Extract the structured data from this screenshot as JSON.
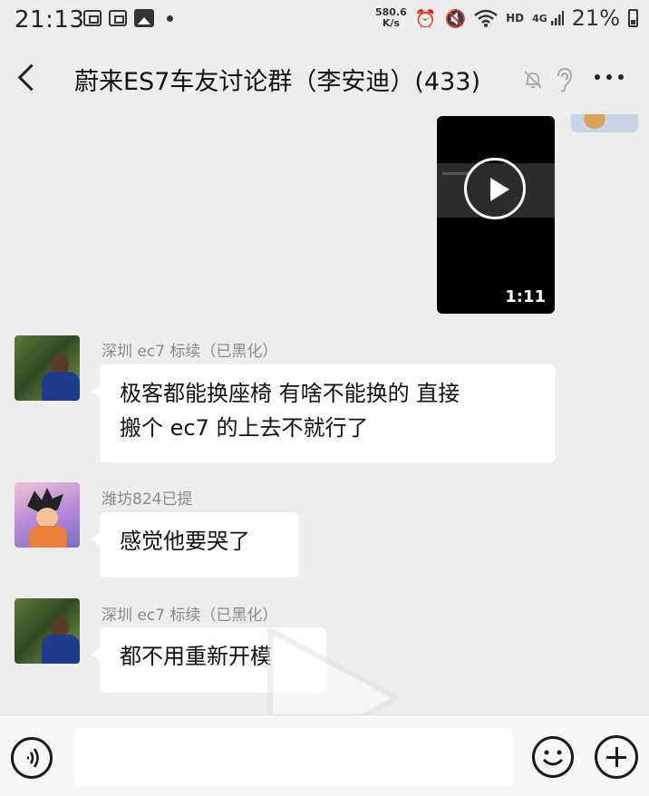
{
  "status_bar": {
    "time": "21:13",
    "net_speed_value": "580.6",
    "net_speed_unit": "K/s",
    "hd_label": "HD",
    "signal_label": "4G",
    "battery": "21%"
  },
  "header": {
    "title": "蔚来ES7车友讨论群（李安迪）(433)"
  },
  "video": {
    "duration": "1:11"
  },
  "messages": [
    {
      "sender": "深圳 ec7 标续（已黑化）",
      "text_line1": "极客都能换座椅 有啥不能换的 直接",
      "text_line2": "搬个 ec7 的上去不就行了",
      "avatar": "avatar-man-outdoor"
    },
    {
      "sender": "潍坊824已提",
      "text": "感觉他要哭了",
      "avatar": "avatar-anime-goku"
    },
    {
      "sender": "深圳 ec7 标续（已黑化）",
      "text": "都不用重新开模",
      "avatar": "avatar-man-outdoor"
    }
  ],
  "icons": {
    "back": "chevron-left-icon",
    "mute": "bell-off-icon",
    "ear": "ear-icon",
    "more": "more-dots-icon",
    "voice": "voice-icon",
    "emoji": "emoji-icon",
    "plus": "plus-icon",
    "play": "play-icon"
  },
  "colors": {
    "background": "#ededed",
    "bubble": "#ffffff",
    "sender_text": "#8a8a8a",
    "input_bar": "#f7f7f7"
  }
}
